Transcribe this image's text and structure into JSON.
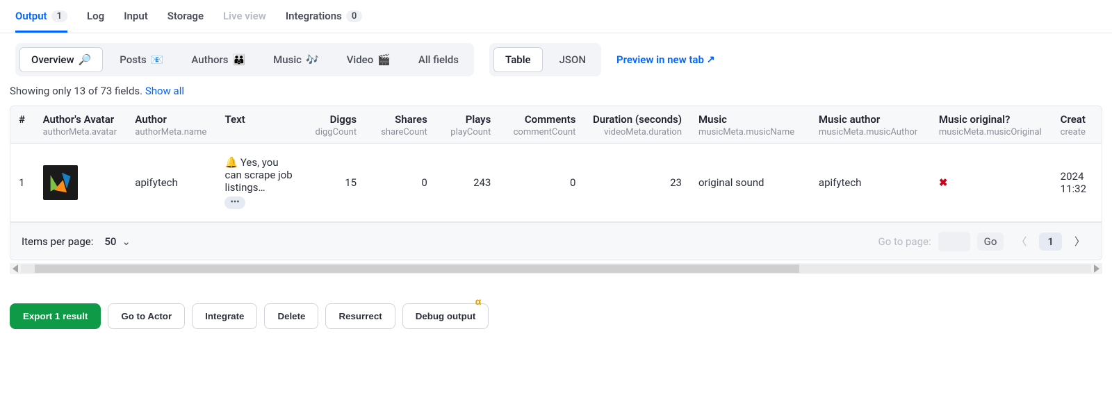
{
  "tabs": [
    {
      "label": "Output",
      "badge": "1",
      "active": true
    },
    {
      "label": "Log"
    },
    {
      "label": "Input"
    },
    {
      "label": "Storage"
    },
    {
      "label": "Live view",
      "disabled": true
    },
    {
      "label": "Integrations",
      "badge": "0"
    }
  ],
  "viewButtons": [
    {
      "label": "Overview",
      "icon": "🔎",
      "active": true
    },
    {
      "label": "Posts",
      "icon": "📧"
    },
    {
      "label": "Authors",
      "icon": "👪"
    },
    {
      "label": "Music",
      "icon": "🎶"
    },
    {
      "label": "Video",
      "icon": "🎬"
    },
    {
      "label": "All fields"
    }
  ],
  "formatButtons": [
    {
      "label": "Table",
      "active": true
    },
    {
      "label": "JSON"
    }
  ],
  "previewLink": "Preview in new tab",
  "fieldsNote": {
    "prefix": "Showing only 13 of 73 fields. ",
    "showAll": "Show all"
  },
  "columns": [
    {
      "label": "#",
      "sub": "",
      "cls": "idx"
    },
    {
      "label": "Author's Avatar",
      "sub": "authorMeta.avatar"
    },
    {
      "label": "Author",
      "sub": "authorMeta.name"
    },
    {
      "label": "Text",
      "sub": ""
    },
    {
      "label": "Diggs",
      "sub": "diggCount",
      "num": true
    },
    {
      "label": "Shares",
      "sub": "shareCount",
      "num": true
    },
    {
      "label": "Plays",
      "sub": "playCount",
      "num": true
    },
    {
      "label": "Comments",
      "sub": "commentCount",
      "num": true
    },
    {
      "label": "Duration (seconds)",
      "sub": "videoMeta.duration",
      "num": true
    },
    {
      "label": "Music",
      "sub": "musicMeta.musicName"
    },
    {
      "label": "Music author",
      "sub": "musicMeta.musicAuthor"
    },
    {
      "label": "Music original?",
      "sub": "musicMeta.musicOriginal"
    },
    {
      "label": "Creat",
      "sub": "create"
    }
  ],
  "rows": [
    {
      "idx": "1",
      "author": "apifytech",
      "text": "🔔 Yes, you can scrape job listings…",
      "diggs": "15",
      "shares": "0",
      "plays": "243",
      "comments": "0",
      "duration": "23",
      "music": "original sound",
      "musicAuthor": "apifytech",
      "musicOriginal": "✖",
      "created": "2024\n11:32"
    }
  ],
  "pager": {
    "itemsPerPageLabel": "Items per page:",
    "itemsPerPage": "50",
    "goToLabel": "Go to page:",
    "goLabel": "Go",
    "currentPage": "1"
  },
  "footerButtons": {
    "export": "Export 1 result",
    "goToActor": "Go to Actor",
    "integrate": "Integrate",
    "delete": "Delete",
    "resurrect": "Resurrect",
    "debug": "Debug output",
    "alpha": "α"
  }
}
